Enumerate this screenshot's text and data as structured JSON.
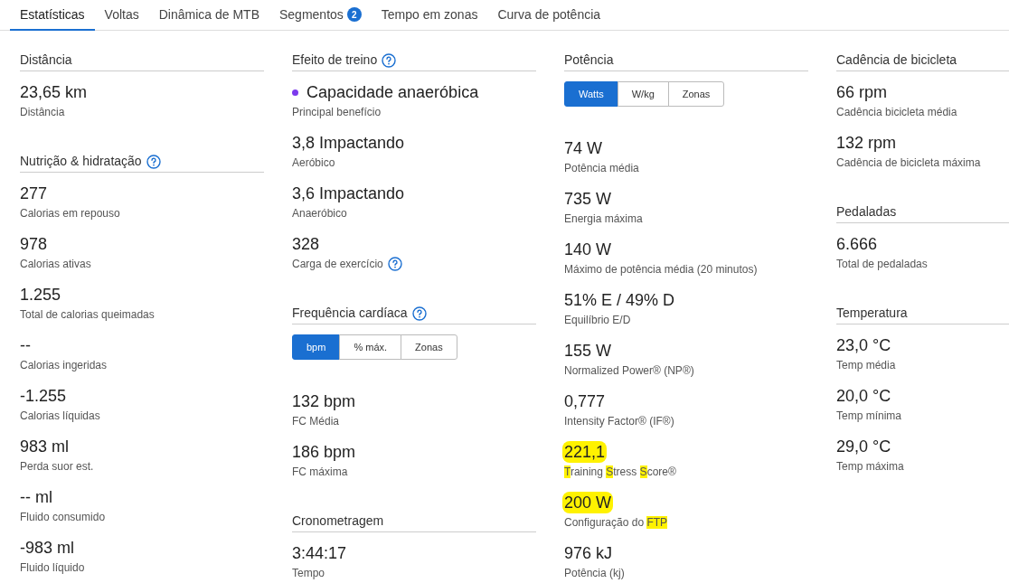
{
  "tabs": [
    {
      "label": "Estatísticas",
      "selected": true
    },
    {
      "label": "Voltas",
      "selected": false
    },
    {
      "label": "Dinâmica de MTB",
      "selected": false
    },
    {
      "label": "Segmentos",
      "selected": false,
      "badge": "2"
    },
    {
      "label": "Tempo em zonas",
      "selected": false
    },
    {
      "label": "Curva de potência",
      "selected": false
    }
  ],
  "columns": [
    {
      "sections": [
        {
          "title": "Distância",
          "items": [
            {
              "value": "23,65 km",
              "label": "Distância"
            }
          ]
        },
        {
          "title": "Nutrição & hidratação",
          "help": true,
          "items": [
            {
              "value": "277",
              "label": "Calorias em repouso"
            },
            {
              "value": "978",
              "label": "Calorias ativas"
            },
            {
              "value": "1.255",
              "label": "Total de calorias queimadas"
            },
            {
              "value": "--",
              "label": "Calorias ingeridas"
            },
            {
              "value": "-1.255",
              "label": "Calorias líquidas"
            },
            {
              "value": "983 ml",
              "label": "Perda suor est."
            },
            {
              "value": "-- ml",
              "label": "Fluido consumido"
            },
            {
              "value": "-983 ml",
              "label": "Fluido líquido"
            }
          ]
        }
      ]
    },
    {
      "sections": [
        {
          "title": "Efeito de treino",
          "help": true,
          "items": [
            {
              "value": "Capacidade anaeróbica",
              "color": "#7c3aed",
              "label": "Principal benefício"
            },
            {
              "value": "3,8 Impactando",
              "label": "Aeróbico"
            },
            {
              "value": "3,6 Impactando",
              "label": "Anaeróbico"
            },
            {
              "value": "328",
              "label": "Carga de exercício",
              "label_help": true
            }
          ]
        },
        {
          "title": "Frequência cardíaca",
          "help": true,
          "toggle": [
            {
              "label": "bpm",
              "selected": true
            },
            {
              "label": "% máx.",
              "selected": false
            },
            {
              "label": "Zonas",
              "selected": false
            }
          ],
          "items": [
            {
              "value": "132 bpm",
              "label": "FC Média"
            },
            {
              "value": "186 bpm",
              "label": "FC máxima"
            }
          ]
        },
        {
          "title": "Cronometragem",
          "items": [
            {
              "value": "3:44:17",
              "label": "Tempo"
            }
          ]
        }
      ]
    },
    {
      "sections": [
        {
          "title": "Potência",
          "toggle": [
            {
              "label": "Watts",
              "selected": true
            },
            {
              "label": "W/kg",
              "selected": false
            },
            {
              "label": "Zonas",
              "selected": false
            }
          ],
          "items": [
            {
              "value": "74 W",
              "label": "Potência média"
            },
            {
              "value": "735 W",
              "label": "Energia máxima"
            },
            {
              "value": "140 W",
              "label": "Máximo de potência média (20 minutos)"
            },
            {
              "value": "51% E / 49% D",
              "label": "Equilíbrio E/D"
            },
            {
              "value": "155 W",
              "label": "Normalized Power® (NP®)"
            },
            {
              "value": "0,777",
              "label": "Intensity Factor® (IF®)"
            },
            {
              "value": "221,1",
              "highlighted": true,
              "label": [
                {
                  "text": "T",
                  "highlighted": true
                },
                {
                  "text": "raining "
                },
                {
                  "text": "S",
                  "highlighted": true
                },
                {
                  "text": "tress "
                },
                {
                  "text": "S",
                  "highlighted": true
                },
                {
                  "text": "core®"
                }
              ]
            },
            {
              "value": "200 W",
              "highlighted": true,
              "label": [
                {
                  "text": "Configuração do "
                },
                {
                  "text": "FTP",
                  "highlighted": true
                }
              ]
            },
            {
              "value": "976 kJ",
              "label": "Potência (kj)"
            }
          ]
        }
      ]
    },
    {
      "sections": [
        {
          "title": "Cadência de bicicleta",
          "items": [
            {
              "value": "66 rpm",
              "label": "Cadência bicicleta média"
            },
            {
              "value": "132 rpm",
              "label": "Cadência de bicicleta máxima"
            }
          ]
        },
        {
          "title": "Pedaladas",
          "items": [
            {
              "value": "6.666",
              "label": "Total de pedaladas"
            }
          ]
        },
        {
          "title": "Temperatura",
          "items": [
            {
              "value": "23,0 °C",
              "label": "Temp média"
            },
            {
              "value": "20,0 °C",
              "label": "Temp mínima"
            },
            {
              "value": "29,0 °C",
              "label": "Temp máxima"
            }
          ]
        }
      ]
    }
  ]
}
